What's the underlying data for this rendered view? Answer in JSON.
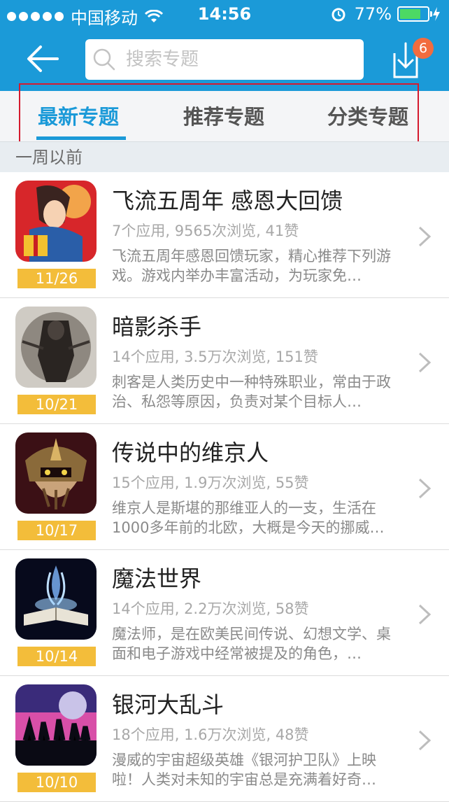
{
  "status_bar": {
    "carrier": "中国移动",
    "time": "14:56",
    "battery": "77%"
  },
  "header": {
    "search_placeholder": "搜索专题",
    "download_badge": "6"
  },
  "tabs": [
    {
      "label": "最新专题",
      "active": true
    },
    {
      "label": "推荐专题",
      "active": false
    },
    {
      "label": "分类专题",
      "active": false
    }
  ],
  "section": {
    "label": "一周以前"
  },
  "items": [
    {
      "title": "飞流五周年 感恩大回馈",
      "meta": "7个应用, 9565次浏览, 41赞",
      "desc": "飞流五周年感恩回馈玩家，精心推荐下列游戏。游戏内举办丰富活动，为玩家免…",
      "date": "11/26",
      "icon": "warrior-gift-icon"
    },
    {
      "title": "暗影杀手",
      "meta": "14个应用, 3.5万次浏览, 151赞",
      "desc": "刺客是人类历史中一种特殊职业，常由于政治、私怨等原因，负责对某个目标人…",
      "date": "10/21",
      "icon": "shadow-assassin-icon"
    },
    {
      "title": "传说中的维京人",
      "meta": "15个应用, 1.9万次浏览, 55赞",
      "desc": "维京人是斯堪的那维亚人的一支，生活在1000多年前的北欧，大概是今天的挪威…",
      "date": "10/17",
      "icon": "viking-helmet-icon"
    },
    {
      "title": "魔法世界",
      "meta": "14个应用, 2.2万次浏览, 58赞",
      "desc": "魔法师，是在欧美民间传说、幻想文学、桌面和电子游戏中经常被提及的角色，…",
      "date": "10/14",
      "icon": "magic-book-icon"
    },
    {
      "title": "银河大乱斗",
      "meta": "18个应用, 1.6万次浏览, 48赞",
      "desc": "漫威的宇宙超级英雄《银河护卫队》上映啦！人类对未知的宇宙总是充满着好奇…",
      "date": "10/10",
      "icon": "galaxy-heroes-icon"
    }
  ],
  "colors": {
    "brand_blue": "#1b9ad8",
    "date_badge": "#f3bd3a",
    "download_badge": "#f26c3f",
    "highlight_box": "#d51a2e"
  }
}
